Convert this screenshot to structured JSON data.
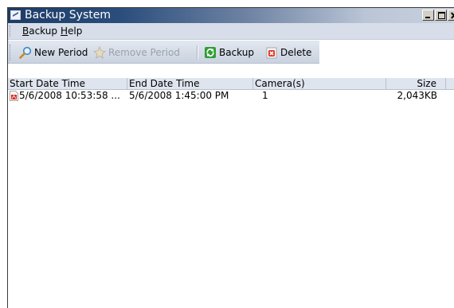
{
  "window": {
    "title": "Backup System"
  },
  "menu": {
    "items": [
      "Backup",
      "Help"
    ]
  },
  "toolbar": {
    "new_period": "New Period",
    "remove_period": "Remove Period",
    "backup": "Backup",
    "delete": "Delete"
  },
  "list": {
    "columns": [
      "Start Date Time",
      "End Date Time",
      "Camera(s)",
      "Size"
    ],
    "rows": [
      {
        "start": "5/6/2008 10:53:58 ...",
        "end": "5/6/2008 1:45:00 PM",
        "cameras": "1",
        "size": "2,043KB"
      }
    ]
  },
  "colors": {
    "titlebar_dark": "#1d3c66",
    "menubar": "#d7dee9",
    "toolbar": "#d3dae5"
  },
  "icons": [
    "app-icon",
    "magnifier-icon",
    "remove-star-icon",
    "backup-refresh-icon",
    "delete-x-icon",
    "pdf-file-icon"
  ]
}
